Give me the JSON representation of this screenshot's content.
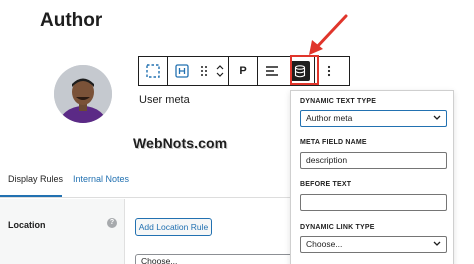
{
  "page": {
    "title": "Author"
  },
  "block": {
    "text": "User meta"
  },
  "watermark": "WebNots.com",
  "toolbar": {
    "paragraph_label": "P",
    "icons": [
      "select-parent-icon",
      "heading-block-icon",
      "drag-handle-icon",
      "move-arrows-icon",
      "align-icon",
      "dynamic-data-icon",
      "more-options-icon"
    ]
  },
  "popover": {
    "dynamic_text_type_label": "DYNAMIC TEXT TYPE",
    "dynamic_text_type_value": "Author meta",
    "meta_field_name_label": "META FIELD NAME",
    "meta_field_name_value": "description",
    "before_text_label": "BEFORE TEXT",
    "before_text_value": "",
    "dynamic_link_type_label": "DYNAMIC LINK TYPE",
    "dynamic_link_type_value": "Choose..."
  },
  "tabs": [
    {
      "label": "Display Rules"
    },
    {
      "label": "Internal Notes"
    }
  ],
  "location": {
    "label": "Location",
    "help": "?",
    "add_button": "Add Location Rule",
    "choose_value": "Choose..."
  },
  "colors": {
    "accent": "#2271b1",
    "highlight": "#e0352b",
    "text": "#1e1e1e"
  }
}
